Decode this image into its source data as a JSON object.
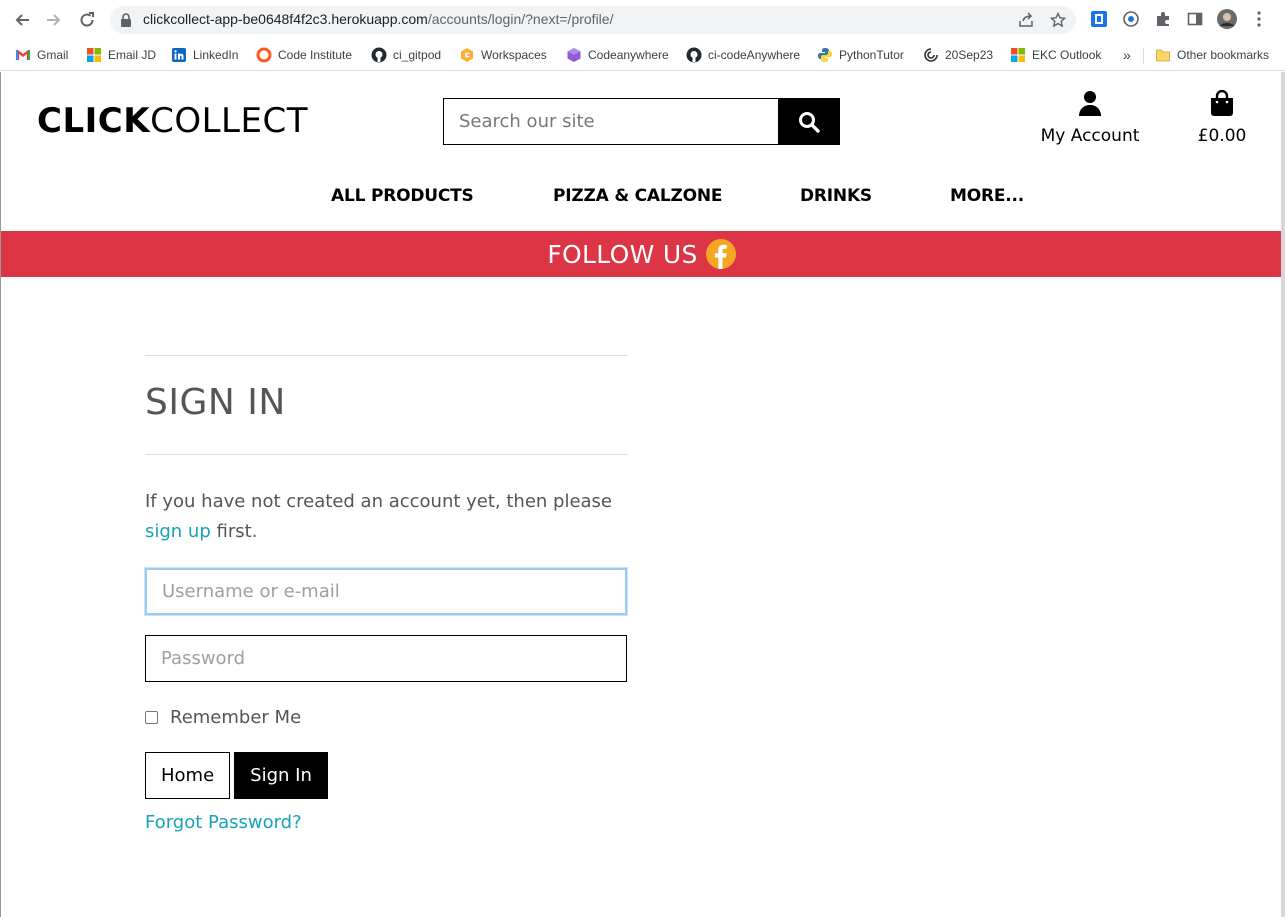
{
  "browser": {
    "url_main": "clickcollect-app-be0648f4f2c3.herokuapp.com",
    "url_path": "/accounts/login/?next=/profile/",
    "bookmarks": [
      {
        "label": "Gmail"
      },
      {
        "label": "Email JD"
      },
      {
        "label": "LinkedIn"
      },
      {
        "label": "Code Institute"
      },
      {
        "label": "ci_gitpod"
      },
      {
        "label": "Workspaces"
      },
      {
        "label": "Codeanywhere"
      },
      {
        "label": "ci-codeAnywhere"
      },
      {
        "label": "PythonTutor"
      },
      {
        "label": "20Sep23"
      },
      {
        "label": "EKC Outlook"
      }
    ],
    "overflow": "»",
    "other_bookmarks": "Other bookmarks"
  },
  "header": {
    "logo_bold": "CLICK",
    "logo_light": "COLLECT",
    "search_placeholder": "Search our site",
    "account_label": "My Account",
    "bag_total": "£0.00"
  },
  "nav": {
    "items": [
      "ALL PRODUCTS",
      "PIZZA & CALZONE",
      "DRINKS",
      "MORE..."
    ]
  },
  "banner": {
    "text": "FOLLOW US"
  },
  "signin": {
    "title": "SIGN IN",
    "intro": "If you have not created an account yet, then please",
    "signup_link": "sign up",
    "intro_end": "first.",
    "username_placeholder": "Username or e-mail",
    "password_placeholder": "Password",
    "remember_label": "Remember Me",
    "home_button": "Home",
    "signin_button": "Sign In",
    "forgot_link": "Forgot Password?"
  },
  "colors": {
    "banner": "#dc3545",
    "link": "#17a2b8",
    "facebook": "#f5a623"
  }
}
